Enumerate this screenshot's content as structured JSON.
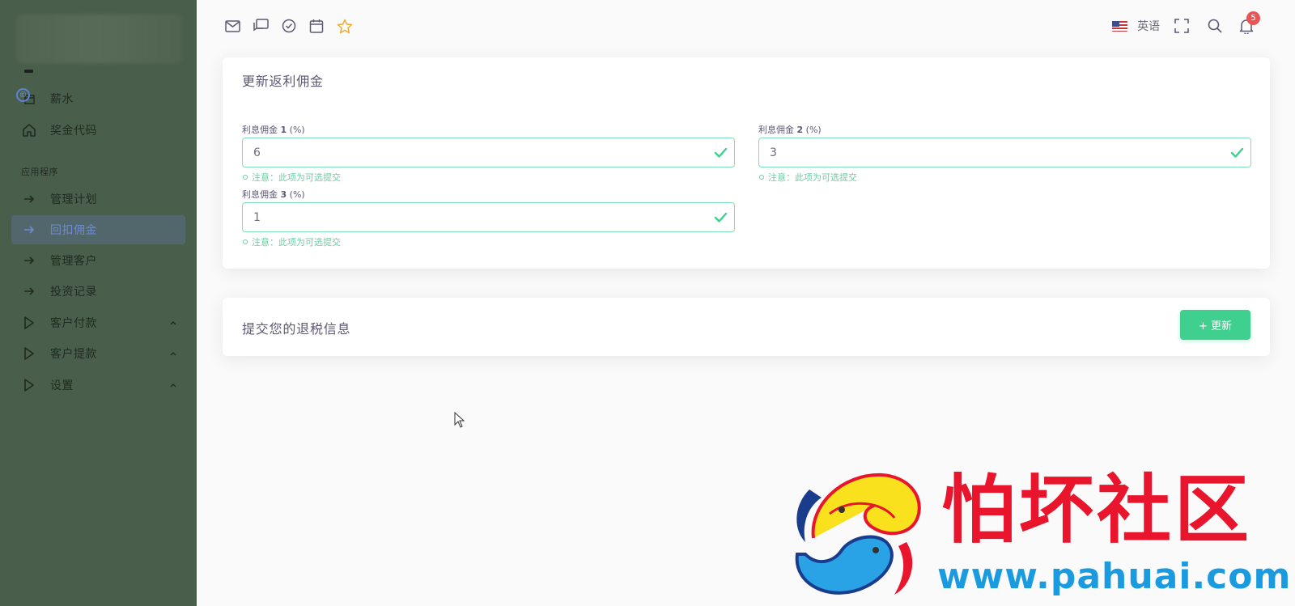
{
  "sidebar": {
    "items_top": [
      {
        "label": "薪水",
        "icon": "wallet-icon"
      },
      {
        "label": "奖金代码",
        "icon": "home-icon"
      }
    ],
    "section_label": "应用程序",
    "items": [
      {
        "label": "管理计划",
        "icon": "arrow-right-icon"
      },
      {
        "label": "回扣佣金",
        "icon": "arrow-right-icon",
        "active": true
      },
      {
        "label": "管理客户",
        "icon": "arrow-right-icon"
      },
      {
        "label": "投资记录",
        "icon": "arrow-right-icon"
      },
      {
        "label": "客户付款",
        "icon": "play-icon",
        "expandable": true
      },
      {
        "label": "客户提款",
        "icon": "play-icon",
        "expandable": true
      },
      {
        "label": "设置",
        "icon": "play-icon",
        "expandable": true
      }
    ]
  },
  "topbar": {
    "shortcuts": [
      "mail-icon",
      "chat-icon",
      "check-circle-icon",
      "calendar-icon",
      "star-icon"
    ],
    "language": "英语",
    "notification_count": "5"
  },
  "commission_form": {
    "title": "更新返利佣金",
    "fields": [
      {
        "label_prefix": "利息佣金 ",
        "label_num": "1",
        "label_suffix": " (%)",
        "value": "6",
        "note": "注意：此项为可选提交"
      },
      {
        "label_prefix": "利息佣金 ",
        "label_num": "2",
        "label_suffix": " (%)",
        "value": "3",
        "note": "注意：此项为可选提交"
      },
      {
        "label_prefix": "利息佣金 ",
        "label_num": "3",
        "label_suffix": " (%)",
        "value": "1",
        "note": "注意：此项为可选提交"
      }
    ]
  },
  "submit_card": {
    "title": "提交您的退税信息",
    "button_label": "+ 更新"
  },
  "watermark": {
    "title": "怕坏社区",
    "url": "www.pahuai.com"
  },
  "colors": {
    "sidebar_bg": "#4a5f4b",
    "accent_green": "#3fcf8e",
    "valid_border": "#7be0b4",
    "badge_red": "#ea5455",
    "star": "#f0a830",
    "watermark_red": "#e8152c",
    "watermark_blue": "#1a9be0"
  }
}
